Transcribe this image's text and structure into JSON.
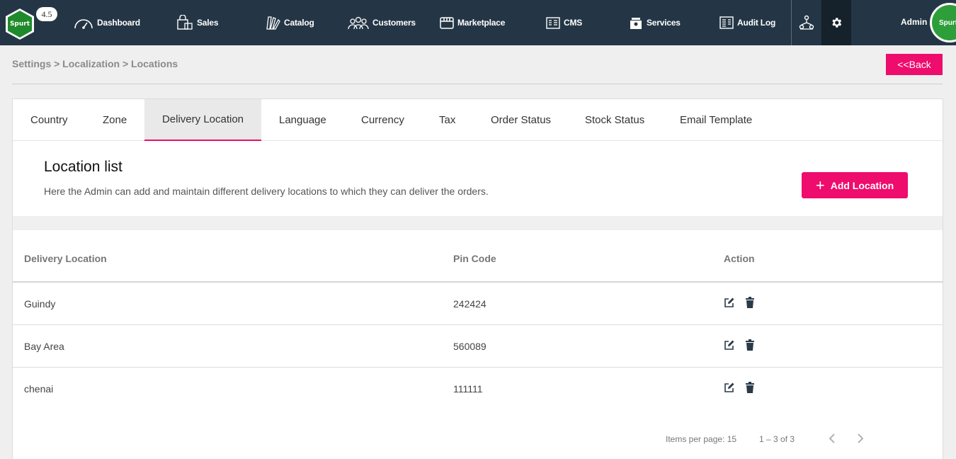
{
  "app": {
    "version": "4.5",
    "logo_text": "Spurt",
    "avatar_text": "Spurt"
  },
  "nav": {
    "items": [
      {
        "label": "Dashboard",
        "icon": "speedometer-icon"
      },
      {
        "label": "Sales",
        "icon": "shopping-bag-icon"
      },
      {
        "label": "Catalog",
        "icon": "catalog-icon"
      },
      {
        "label": "Customers",
        "icon": "customers-icon"
      },
      {
        "label": "Marketplace",
        "icon": "store-icon"
      },
      {
        "label": "CMS",
        "icon": "cms-icon"
      },
      {
        "label": "Services",
        "icon": "services-icon"
      },
      {
        "label": "Audit Log",
        "icon": "audit-log-icon"
      }
    ],
    "admin_name": "Admin"
  },
  "breadcrumb": "Settings > Localization > Locations",
  "back_label": "<<Back",
  "tabs": [
    {
      "label": "Country"
    },
    {
      "label": "Zone"
    },
    {
      "label": "Delivery Location",
      "active": true
    },
    {
      "label": "Language"
    },
    {
      "label": "Currency"
    },
    {
      "label": "Tax"
    },
    {
      "label": "Order Status"
    },
    {
      "label": "Stock Status"
    },
    {
      "label": "Email Template"
    }
  ],
  "list": {
    "title": "Location list",
    "description": "Here the Admin can add and maintain different delivery locations to which they can deliver the orders.",
    "add_label": "Add Location"
  },
  "table": {
    "headers": [
      "Delivery Location",
      "Pin Code",
      "Action"
    ],
    "rows": [
      {
        "location": "Guindy",
        "pin": "242424"
      },
      {
        "location": "Bay Area",
        "pin": "560089"
      },
      {
        "location": "chenai",
        "pin": "111111"
      }
    ]
  },
  "pagination": {
    "items_per_page": "Items per page: 15",
    "range": "1 – 3 of 3"
  },
  "colors": {
    "accent": "#ee0c6d",
    "nav_bg": "#243645"
  }
}
